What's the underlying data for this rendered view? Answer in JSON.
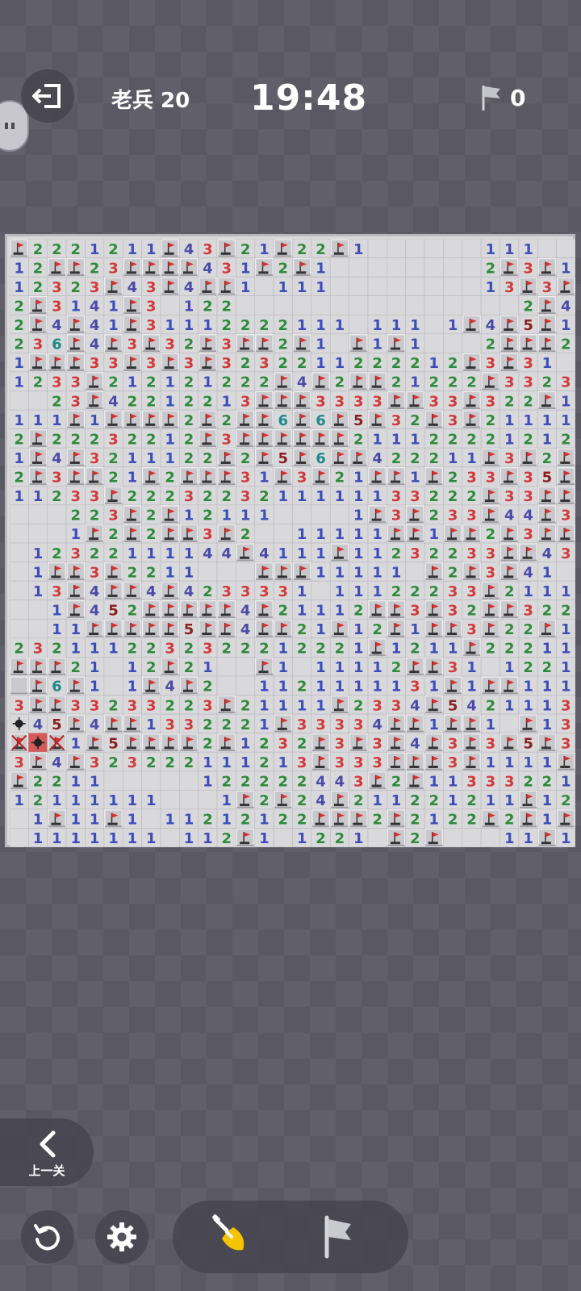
{
  "header": {
    "level_label": "老兵 20",
    "timer": "19:48",
    "flag_count": "0"
  },
  "board": {
    "cols": 30,
    "rows": 32,
    "colors": {
      "n1": "#3d4eb8",
      "n2": "#2e8b3a",
      "n3": "#d23a3a",
      "n4": "#4a4aa8",
      "n5": "#8a2020",
      "n6": "#1f8a8a",
      "revealed": "#d9d9dc",
      "hidden": "#c8c8cd",
      "flag": "#d8322c",
      "exploded": "#d65a5a"
    },
    "legend": "F=flag, H=hidden, 0=empty revealed, M=mine, X=wrong flag, E=exploded mine",
    "rows_data": [
      "F2221211F43F21F22F1000000111000",
      "12FF23FFFF431F2F1000000002F3F121",
      "12323F43F4FF101110000000013F3F3FF3",
      "2F3141F301220000000000000002F43233F",
      "2F4F41F31112222111011101F4F5F1122",
      "236F4F3F32F3FF2F10F1F10002FFF21",
      "1FFF33F3F3F3232211222212F3F31",
      "1233F212121222F4F2FF21222F3323111",
      "0023F42212213FFF3333FF33F322F1F222",
      "111F1FFFF2F2FF6F6F5F32F3F21111F21F",
      "2F22232212F3FFFFFF21112222121213F5F",
      "1F4F3211122F2F5F6FF422211F3F2F4FF",
      "2F3FF21F2FFF31F3F21FF1F233F35F5FF3",
      "11233F2223223211111133222F33FFFF41",
      "000223F2F1211100001F3F233F44F33F2",
      "0001F2F2FF3F20011111FF1FF2F3FF4FFF21",
      "012322111144F4111F11232233FF4322F1",
      "01FF3F2211000FFF111110F2F3F41011111",
      "013F4FF4F4233331011122233F2111111",
      "001F452FFFFF4F21112FF3F32FF3222F21",
      "0011FFFFF5FF4FF21F12F1FF3F22F111FF3F1",
      "2321112232322212221F1211F22211112111",
      "FFF21012F2100F1011112FF3101221",
      "HF6F101F4F2001121111131F1FF111",
      "3FF33233223F21111F2334F54211133F421",
      "M45F4FF1332221F33334FF1FF10F13F1",
      "XEX1F5FFFF2F1232F3F3F4F3F3F5F3222333F2F1",
      "3F4F323222111213F333FFF3F1111F1F2FF431",
      "F221100000122222443F2F11333221FF1",
      "121111110001F2F24F211221211F1221F21",
      "01F11F1011212122FFF2F2122F2F1F21F2F1",
      "011111110112F1012210F2F00011F12F1"
    ]
  }
}
